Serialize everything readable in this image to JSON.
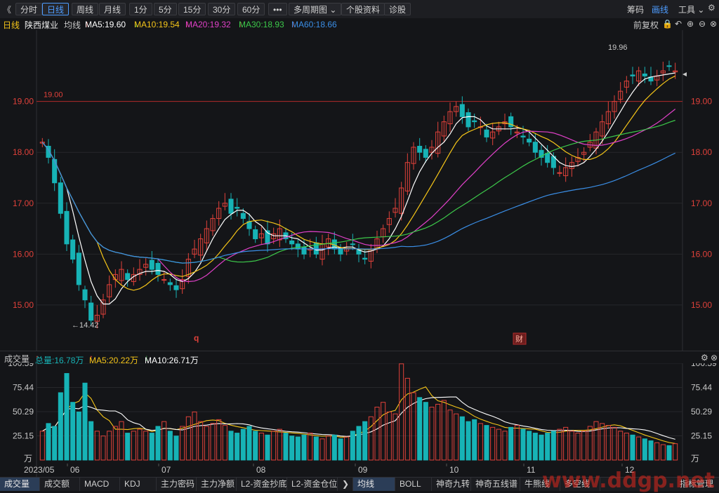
{
  "toolbar": {
    "back": "《",
    "periods": [
      "分时",
      "日线",
      "周线",
      "月线",
      "1分",
      "5分",
      "15分",
      "30分",
      "60分"
    ],
    "active_period": "日线",
    "more": "•••",
    "multi_period": "多周期图",
    "profile": "个股资料",
    "diagnose": "诊股",
    "right": [
      "筹码",
      "画线",
      "工具"
    ],
    "right_active": "画线"
  },
  "legend": {
    "period": "日线",
    "name": "陕西煤业",
    "ma_label": "均线",
    "ma5": "MA5:19.60",
    "ma10": "MA10:19.54",
    "ma20": "MA20:19.32",
    "ma30": "MA30:18.93",
    "ma60": "MA60:18.66",
    "adjust": "前复权",
    "colors": {
      "ma5": "#ffffff",
      "ma10": "#f5c518",
      "ma20": "#e040c8",
      "ma30": "#3cc84a",
      "ma60": "#3a8ee6",
      "up": "#e0413a",
      "down": "#17b3b6"
    }
  },
  "price_chart": {
    "y_ticks": [
      "19.00",
      "18.00",
      "17.00",
      "16.00",
      "15.00"
    ],
    "ref_line": "19.00",
    "high_label": "19.96",
    "low_label": "←14.42",
    "marker_q": "q",
    "marker_cai": "财"
  },
  "volume": {
    "label": "成交量",
    "total": "总量:16.78万",
    "ma5": "MA5:20.22万",
    "ma10": "MA10:26.71万",
    "y_ticks": [
      "100.59",
      "75.44",
      "50.29",
      "25.15"
    ],
    "unit": "万"
  },
  "x_axis": [
    "2023/05",
    "06",
    "07",
    "08",
    "09",
    "10",
    "11",
    "12"
  ],
  "bottom_tabs_left": [
    "成交量",
    "成交额",
    "MACD",
    "KDJ",
    "主力密码",
    "主力净额",
    "L2-资金抄底",
    "L2-资金仓位"
  ],
  "bottom_tabs_right": [
    "均线",
    "BOLL",
    "神奇九转",
    "神奇五线谱",
    "牛熊线",
    "多空线"
  ],
  "bottom_right_btn": "指标管理",
  "watermark": "www.ddgp.net",
  "chart_data": {
    "type": "candlestick",
    "closes": [
      18.2,
      17.9,
      17.4,
      16.8,
      16.2,
      15.9,
      15.4,
      15.1,
      14.7,
      14.8,
      15.1,
      15.4,
      15.6,
      15.7,
      15.5,
      15.6,
      15.7,
      15.8,
      15.7,
      15.6,
      15.5,
      15.4,
      15.3,
      15.5,
      15.9,
      16.1,
      16.3,
      16.5,
      16.7,
      16.9,
      17.0,
      16.8,
      16.9,
      16.7,
      16.5,
      16.3,
      16.4,
      16.2,
      16.4,
      16.5,
      16.3,
      16.2,
      16.1,
      16.0,
      16.1,
      16.0,
      16.2,
      16.3,
      16.1,
      16.0,
      16.1,
      16.2,
      16.0,
      15.9,
      16.1,
      16.3,
      16.5,
      16.7,
      16.9,
      17.3,
      17.8,
      18.1,
      18.0,
      17.9,
      18.1,
      18.4,
      18.6,
      18.8,
      18.9,
      18.7,
      18.5,
      18.6,
      18.5,
      18.3,
      18.4,
      18.5,
      18.6,
      18.5,
      18.4,
      18.3,
      18.2,
      18.0,
      17.9,
      17.8,
      17.7,
      17.6,
      17.7,
      17.8,
      17.9,
      18.0,
      18.2,
      18.4,
      18.6,
      18.8,
      19.0,
      19.2,
      19.4,
      19.5,
      19.6,
      19.5,
      19.4,
      19.5,
      19.6,
      19.7,
      19.6
    ],
    "volumes": [
      30,
      38,
      35,
      70,
      90,
      60,
      50,
      80,
      40,
      30,
      25,
      30,
      35,
      40,
      28,
      30,
      32,
      30,
      28,
      35,
      40,
      30,
      25,
      35,
      45,
      50,
      40,
      35,
      38,
      42,
      36,
      30,
      28,
      32,
      35,
      30,
      28,
      26,
      30,
      32,
      28,
      25,
      24,
      26,
      28,
      24,
      22,
      25,
      26,
      22,
      24,
      30,
      35,
      40,
      45,
      55,
      60,
      50,
      48,
      100,
      85,
      70,
      65,
      60,
      55,
      58,
      62,
      52,
      48,
      45,
      40,
      42,
      38,
      36,
      34,
      32,
      30,
      34,
      36,
      32,
      30,
      28,
      26,
      28,
      30,
      32,
      34,
      30,
      28,
      30,
      35,
      40,
      38,
      36,
      34,
      30,
      28,
      26,
      24,
      22,
      20,
      18,
      16,
      15,
      17
    ],
    "y_range": [
      14.42,
      19.96
    ],
    "volume_range": [
      0,
      100.59
    ]
  }
}
